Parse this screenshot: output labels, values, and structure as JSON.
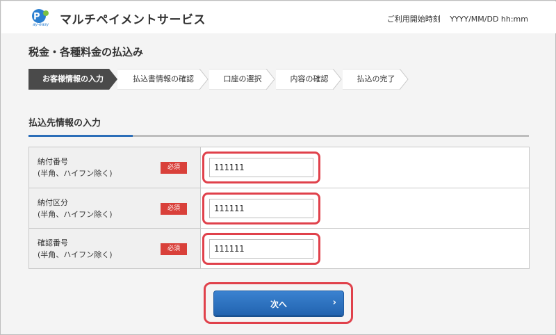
{
  "header": {
    "site_title": "マルチペイメントサービス",
    "start_label": "ご利用開始時刻",
    "start_value": "YYYY/MM/DD hh:mm",
    "logo_icon": "pay-easy-logo"
  },
  "page_title": "税金・各種料金の払込み",
  "steps": [
    {
      "label": "お客様情報の入力",
      "active": true
    },
    {
      "label": "払込書情報の確認",
      "active": false
    },
    {
      "label": "口座の選択",
      "active": false
    },
    {
      "label": "内容の確認",
      "active": false
    },
    {
      "label": "払込の完了",
      "active": false
    }
  ],
  "section": {
    "title": "払込先情報の入力"
  },
  "form": {
    "rows": [
      {
        "label": "納付番号",
        "sublabel": "(半角、ハイフン除く)",
        "required": "必須",
        "value": "111111"
      },
      {
        "label": "納付区分",
        "sublabel": "(半角、ハイフン除く)",
        "required": "必須",
        "value": "111111"
      },
      {
        "label": "確認番号",
        "sublabel": "(半角、ハイフン除く)",
        "required": "必須",
        "value": "111111"
      }
    ]
  },
  "next_button": {
    "label": "次へ",
    "chevron": "›"
  },
  "colors": {
    "active_step": "#4a4a4a",
    "accent": "#2c6eb8",
    "required_badge": "#d9403a",
    "highlight": "#e0414b",
    "button": "#2b71c0"
  }
}
